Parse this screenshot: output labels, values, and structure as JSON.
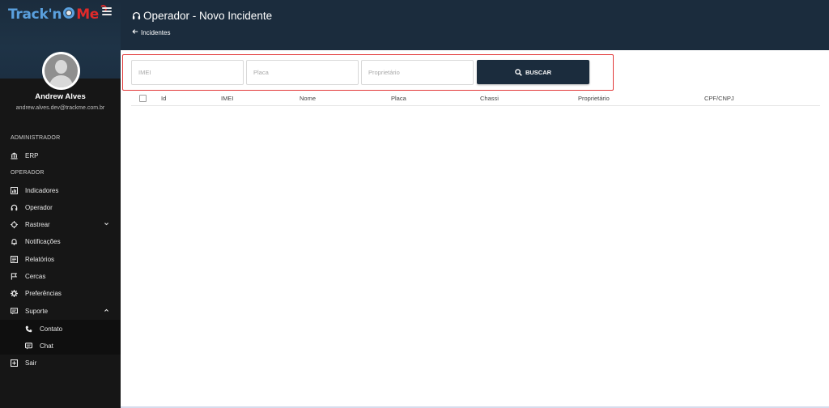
{
  "app": {
    "logo_part1": "Track'n",
    "logo_part2": "Me"
  },
  "user": {
    "name": "Andrew Alves",
    "email": "andrew.alves.dev@trackme.com.br"
  },
  "sidebar": {
    "section_admin": "ADMINISTRADOR",
    "section_operator": "OPERADOR",
    "items": [
      {
        "label": "ERP",
        "icon": "bank-icon"
      },
      {
        "label": "Indicadores",
        "icon": "chart-icon"
      },
      {
        "label": "Operador",
        "icon": "headset-icon"
      },
      {
        "label": "Rastrear",
        "icon": "crosshair-icon"
      },
      {
        "label": "Notificações",
        "icon": "bell-icon"
      },
      {
        "label": "Relatórios",
        "icon": "report-icon"
      },
      {
        "label": "Cercas",
        "icon": "flag-icon"
      },
      {
        "label": "Preferências",
        "icon": "gear-icon"
      },
      {
        "label": "Suporte",
        "icon": "comment-icon"
      },
      {
        "label": "Contato",
        "icon": "phone-icon"
      },
      {
        "label": "Chat",
        "icon": "chat-icon"
      },
      {
        "label": "Sair",
        "icon": "exit-icon"
      }
    ]
  },
  "header": {
    "title": "Operador - Novo Incidente",
    "breadcrumb": "Incidentes"
  },
  "search": {
    "imei_placeholder": "IMEI",
    "placa_placeholder": "Placa",
    "proprietario_placeholder": "Proprietário",
    "button_label": "BUSCAR"
  },
  "table": {
    "columns": [
      "Id",
      "IMEI",
      "Nome",
      "Placa",
      "Chassi",
      "Proprietário",
      "CPF/CNPJ"
    ],
    "rows": []
  },
  "colors": {
    "primary": "#1b2c3d",
    "sidebar_bg": "#161616",
    "highlight_border": "#e23b3b",
    "logo_blue": "#5aa0de",
    "logo_red": "#e02a2a"
  }
}
